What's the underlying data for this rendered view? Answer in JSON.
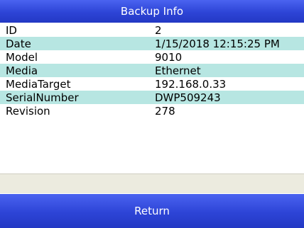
{
  "header": {
    "title": "Backup Info"
  },
  "rows": [
    {
      "key": "ID",
      "value": "2"
    },
    {
      "key": "Date",
      "value": "1/15/2018 12:15:25 PM"
    },
    {
      "key": "Model",
      "value": "9010"
    },
    {
      "key": "Media",
      "value": "Ethernet"
    },
    {
      "key": "MediaTarget",
      "value": "192.168.0.33"
    },
    {
      "key": "SerialNumber",
      "value": "DWP509243"
    },
    {
      "key": "Revision",
      "value": "278"
    }
  ],
  "footer": {
    "return_label": "Return"
  },
  "colors": {
    "header_blue": "#2d44d6",
    "row_alt": "#b7e6e2",
    "status_bar": "#ecebdf"
  }
}
